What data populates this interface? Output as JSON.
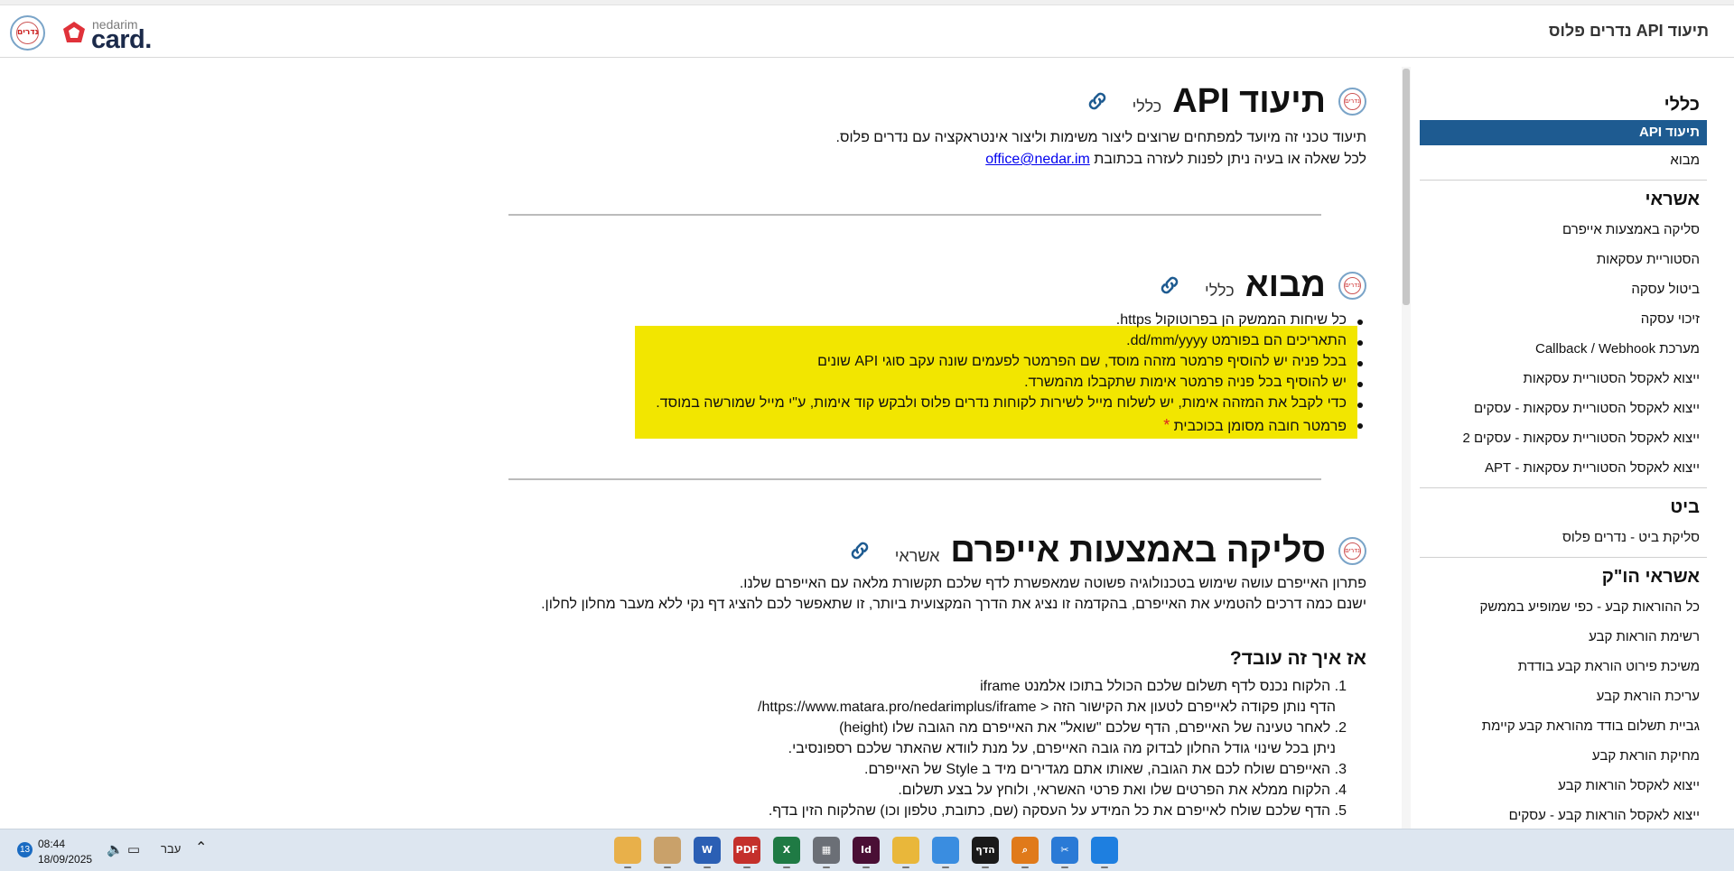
{
  "header": {
    "title": "תיעוד API נדרים פלוס",
    "logo_small": "nedarim",
    "logo_big": "card.",
    "logo_seal": "נדרים"
  },
  "sidebar": {
    "sections": [
      {
        "title": "כללי",
        "items": [
          {
            "label": "תיעוד API",
            "active": true
          },
          {
            "label": "מבוא"
          }
        ]
      },
      {
        "title": "אשראי",
        "items": [
          {
            "label": "סליקה באמצעות אייפרם"
          },
          {
            "label": "הסטוריית עסקאות"
          },
          {
            "label": "ביטול עסקה"
          },
          {
            "label": "זיכוי עסקה"
          },
          {
            "label": "מערכת Callback / Webhook"
          },
          {
            "label": "ייצוא לאקסל הסטוריית עסקאות"
          },
          {
            "label": "ייצוא לאקסל הסטוריית עסקאות - עסקים"
          },
          {
            "label": "ייצוא לאקסל הסטוריית עסקאות - עסקים 2"
          },
          {
            "label": "ייצוא לאקסל הסטוריית עסקאות - APT"
          }
        ]
      },
      {
        "title": "ביט",
        "items": [
          {
            "label": "סליקת ביט - נדרים פלוס"
          }
        ]
      },
      {
        "title": "אשראי הו\"ק",
        "items": [
          {
            "label": "כל ההוראות קבע - כפי שמופיע בממשק"
          },
          {
            "label": "רשימת הוראות קבע"
          },
          {
            "label": "משיכת פירוט הוראת קבע בודדת"
          },
          {
            "label": "עריכת הוראת קבע"
          },
          {
            "label": "גביית תשלום בודד מהוראת קבע קיימת"
          },
          {
            "label": "מחיקת הוראת קבע"
          },
          {
            "label": "ייצוא לאקסל הוראות קבע"
          },
          {
            "label": "ייצוא לאקסל הוראות קבע - עסקים"
          }
        ]
      }
    ]
  },
  "content": {
    "s1": {
      "title": "תיעוד API",
      "tag": "כללי",
      "p1": "תיעוד טכני זה מיועד למפתחים שרוצים ליצור משימות וליצור אינטראקציה עם נדרים פלוס.",
      "p2_text": "לכל שאלה או בעיה ניתן לפנות לעזרה בכתובת",
      "p2_link": "office@nedar.im"
    },
    "s2": {
      "title": "מבוא",
      "tag": "כללי",
      "bullets": [
        "כל שיחות הממשק הן בפרוטוקול https.",
        "התאריכים הם בפורמט dd/mm/yyyy.",
        "בכל פניה יש להוסיף פרמטר מזהה מוסד, שם הפרמטר לפעמים שונה עקב סוגי API שונים",
        "יש להוסיף בכל פניה פרמטר אימות שתקבלו מהמשרד.",
        "כדי לקבל את המזהה אימות, יש לשלוח מייל לשירות לקוחות נדרים פלוס ולבקש קוד אימות, ע\"י מייל שמורשה במוסד.",
        "פרמטר חובה מסומן בכוכבית"
      ],
      "star": "*"
    },
    "s3": {
      "title": "סליקה באמצעות אייפרם",
      "tag": "אשראי",
      "p1": "פתרון האייפרם עושה שימוש בטכנולוגיה פשוטה שמאפשרת לדף שלכם תקשורת מלאה עם האייפרם שלנו.",
      "p2": "ישנם כמה דרכים להטמיע את האייפרם, בהקדמה זו נציג את הדרך המקצועית ביותר, זו שתאפשר לכם להציג דף נקי ללא מעבר מחלון לחלון.",
      "subtitle": "אז איך זה עובד?",
      "steps": [
        "1. הלקוח נכנס לדף תשלום שלכם הכולל בתוכו אלמנט iframe",
        "הדף נותן פקודה לאייפרם לטעון את הקישור הזה < https://www.matara.pro/nedarimplus/iframe/",
        "2. לאחר טעינה של האייפרם, הדף שלכם \"שואל\" את האייפרם מה הגובה שלו (height)",
        "ניתן בכל שינוי גודל החלון לבדוק מה גובה האייפרם, על מנת לוודא שהאתר שלכם רספונסיבי.",
        "3. האייפרם שולח לכם את הגובה, שאותו אתם מגדירים מיד ב Style של האייפרם.",
        "4. הלקוח ממלא את הפרטים שלו ואת פרטי האשראי, ולוחץ על בצע תשלום.",
        "5. הדף שלכם שולח לאייפרם את כל המידע על העסקה (שם, כתובת, טלפון וכו) שהלקוח הזין בדף."
      ]
    }
  },
  "taskbar": {
    "badge": "13",
    "time": "08:44",
    "date": "18/09/2025",
    "lang": "עבר",
    "apps": [
      {
        "name": "chrome-profile-1",
        "label": "",
        "color": "#e8b04a"
      },
      {
        "name": "chrome-profile-2",
        "label": "",
        "color": "#c9a16a"
      },
      {
        "name": "word",
        "label": "W",
        "color": "#2b5fb4"
      },
      {
        "name": "pdf",
        "label": "PDF",
        "color": "#c4302b"
      },
      {
        "name": "excel",
        "label": "X",
        "color": "#1f7a44"
      },
      {
        "name": "calculator",
        "label": "▦",
        "color": "#6b6f76"
      },
      {
        "name": "indesign",
        "label": "Id",
        "color": "#4a0f35"
      },
      {
        "name": "file-explorer",
        "label": "",
        "color": "#e9b73a"
      },
      {
        "name": "chrome",
        "label": "",
        "color": "#3a8de0"
      },
      {
        "name": "news-app",
        "label": "הדף",
        "color": "#1a1a1a"
      },
      {
        "name": "search-app",
        "label": "⌕",
        "color": "#e07a1a"
      },
      {
        "name": "snipping-tool",
        "label": "✂",
        "color": "#2a7ad6"
      },
      {
        "name": "windows-start",
        "label": "",
        "color": "#1e7fe0"
      }
    ]
  }
}
